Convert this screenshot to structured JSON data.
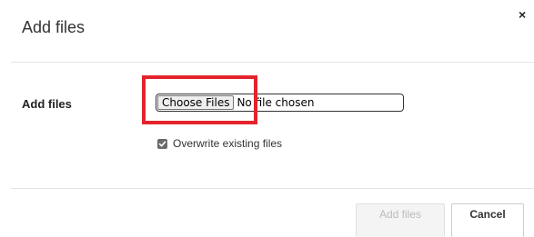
{
  "dialog": {
    "title": "Add files",
    "close_label": "×"
  },
  "form": {
    "field_label": "Add files",
    "choose_button_label": "Choose Files",
    "no_file_text": "No file chosen",
    "overwrite_label": "Overwrite existing files",
    "overwrite_checked": true
  },
  "footer": {
    "add_label": "Add files",
    "cancel_label": "Cancel"
  },
  "colors": {
    "highlight": "#e3242b"
  }
}
